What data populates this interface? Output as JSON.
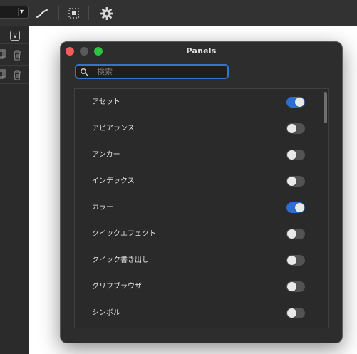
{
  "window": {
    "title": "Panels",
    "search": {
      "placeholder": "検索",
      "value": ""
    }
  },
  "panels": [
    {
      "label": "アセット",
      "enabled": true
    },
    {
      "label": "アピアランス",
      "enabled": false
    },
    {
      "label": "アンカー",
      "enabled": false
    },
    {
      "label": "インデックス",
      "enabled": false
    },
    {
      "label": "カラー",
      "enabled": true
    },
    {
      "label": "クイックエフェクト",
      "enabled": false
    },
    {
      "label": "クイック書き出し",
      "enabled": false
    },
    {
      "label": "グリフブラウザ",
      "enabled": false
    },
    {
      "label": "シンボル",
      "enabled": false
    }
  ],
  "toolbar": {
    "icons": [
      "chevron-down-icon",
      "pen-stroke-icon",
      "selection-marquee-icon",
      "gear-icon"
    ]
  },
  "sidebar": {
    "icons": [
      "collapse-icon",
      "duplicate-icon",
      "trash-icon"
    ]
  },
  "colors": {
    "accent": "#2f77c9",
    "toggle_on": "#2f6dd6",
    "window_bg": "#2d2d2d",
    "close": "#ed5f57",
    "maximize": "#2cc540"
  }
}
